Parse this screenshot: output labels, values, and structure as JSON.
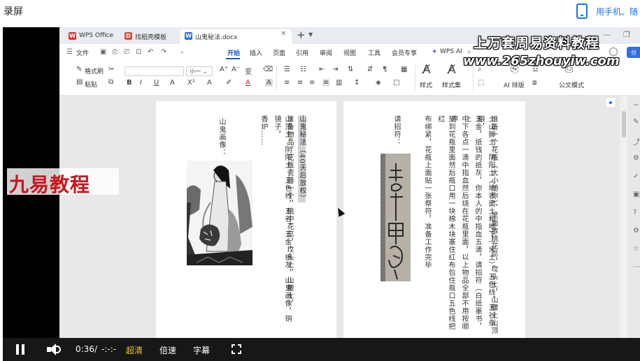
{
  "app": {
    "title": "录屏"
  },
  "phone_link": "用手机、随",
  "watermark": {
    "site_cn": "上万套周易资料教程",
    "site_url": "www.265zhouyiw.com",
    "brand": "九易教程"
  },
  "wps": {
    "tabs": [
      {
        "label": "WPS Office"
      },
      {
        "label": "找稻壳模板"
      },
      {
        "label": "山鬼秘法.docx"
      }
    ],
    "menu": {
      "file": "文件",
      "items": [
        "开始",
        "插入",
        "页面",
        "引用",
        "审阅",
        "视图",
        "工具",
        "会员专享"
      ],
      "wps_ai": "WPS AI",
      "share": "分"
    },
    "toolbar": {
      "format_brush": "格式刷",
      "paste": "粘贴",
      "font_size": "小一",
      "style": "样式",
      "style_set": "样式集",
      "ai_layout": "AI 排版",
      "official_mode": "公文模式"
    }
  },
  "document": {
    "left_page": {
      "title": "山鬼秘法（40天后放权）",
      "col1": "准备物品，花瓶瓷器一个，桃中花蕊，坟头土，山腰土，",
      "col2": "山顶土，阴阳土，五色线，五谷，五金，纸灰，山鬼画像，铜镜子，",
      "col3": "香炉……",
      "caption": "山鬼画像："
    },
    "right_page": {
      "col1": "准备一个花瓶（大小随你），里面放桃花蕊，坟头土，山腰土山顶",
      "col2": "土山脚土，阴阳土（地表面土和地下一米土），五色线，五谷杂粮，",
      "col3": "五金，纸钱的纸灰，你本人的中指血五滴，请招符（白纸墨书，上",
      "col4": "中下各点一滴中指血然后烧在花瓶里面，以上物品全部不用按顺序",
      "col5": "放到花瓶里面然后瓶口用一块棉木块塞住红布包住瓶口五色线把红",
      "col6": "布绑紧，花瓶上面贴一张祭符，准备工作完毕",
      "col7": "请招符："
    }
  },
  "player": {
    "time": "0:36",
    "separator": "/",
    "duration": "-:-:-",
    "quality": "超清",
    "speed": "倍速",
    "subtitle": "字幕"
  },
  "colors": {
    "accent": "#1a58d0",
    "quality": "#f5c518",
    "brand_red": "#c8161d"
  }
}
